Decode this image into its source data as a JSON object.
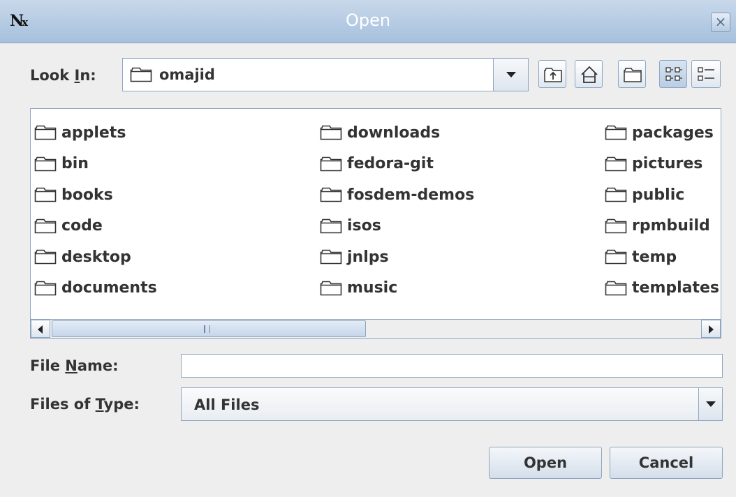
{
  "window": {
    "title": "Open",
    "logo": "N",
    "logo_sub": "x",
    "close": "×"
  },
  "look_in": {
    "label_before": "Look ",
    "label_mnemonic": "I",
    "label_after": "n:",
    "value": "omajid"
  },
  "toolbar": {
    "buttons": [
      {
        "name": "up-one-level",
        "icon": "up-folder-icon"
      },
      {
        "name": "home",
        "icon": "home-icon"
      },
      {
        "name": "new-folder",
        "icon": "new-folder-icon"
      },
      {
        "name": "list-view",
        "icon": "list-view-icon",
        "active": true
      },
      {
        "name": "details-view",
        "icon": "details-view-icon"
      }
    ]
  },
  "files": {
    "columns": [
      [
        "applets",
        "bin",
        "books",
        "code",
        "desktop",
        "documents"
      ],
      [
        "downloads",
        "fedora-git",
        "fosdem-demos",
        "isos",
        "jnlps",
        "music"
      ],
      [
        "packages",
        "pictures",
        "public",
        "rpmbuild",
        "temp",
        "templates"
      ]
    ]
  },
  "file_name": {
    "label_before": "File ",
    "label_mnemonic": "N",
    "label_after": "ame:",
    "value": ""
  },
  "file_type": {
    "label_before": "Files of ",
    "label_mnemonic": "T",
    "label_after": "ype:",
    "value": "All Files"
  },
  "buttons": {
    "open": "Open",
    "cancel": "Cancel"
  }
}
